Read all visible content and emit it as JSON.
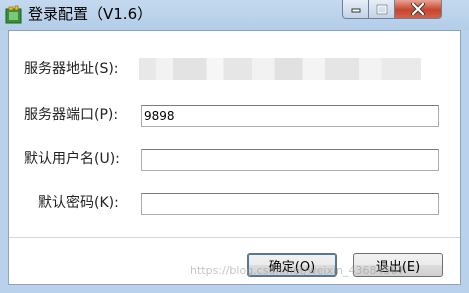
{
  "window": {
    "title": "登录配置（V1.6）"
  },
  "form": {
    "server_address": {
      "label": "服务器地址(S):",
      "value": ""
    },
    "server_port": {
      "label": "服务器端口(P):",
      "value": "9898"
    },
    "default_user": {
      "label": "默认用户名(U):",
      "value": ""
    },
    "default_password": {
      "label": "默认密码(K):",
      "value": ""
    }
  },
  "buttons": {
    "ok": "确定(O)",
    "exit": "退出(E)"
  },
  "watermark": "https://blog.csdn.net/weixin_43684567"
}
